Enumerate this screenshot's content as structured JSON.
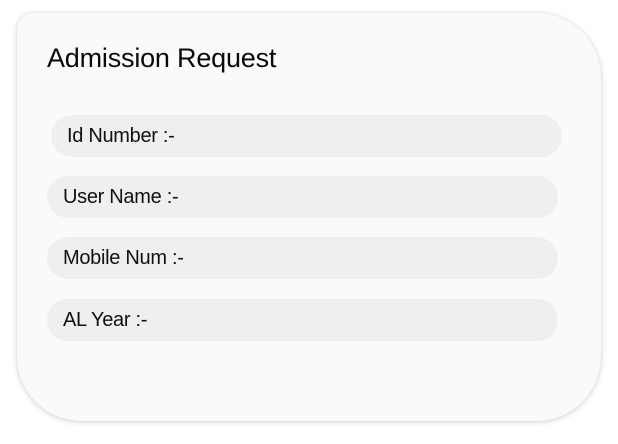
{
  "form": {
    "title": "Admission Request",
    "fields": [
      {
        "label": "Id Number :-"
      },
      {
        "label": "User Name :-"
      },
      {
        "label": "Mobile Num :-"
      },
      {
        "label": "AL Year :-"
      }
    ]
  }
}
